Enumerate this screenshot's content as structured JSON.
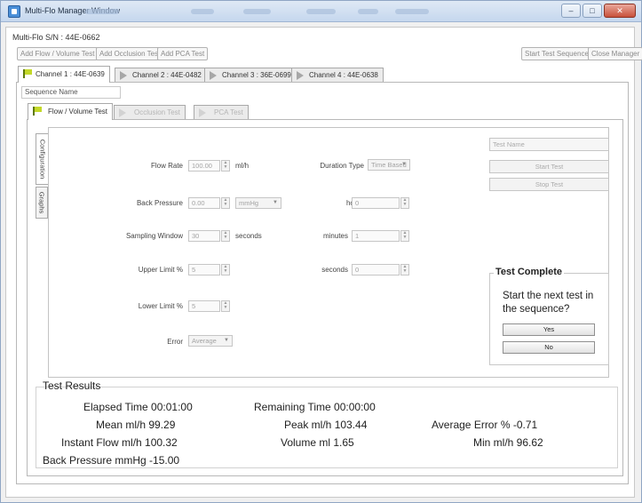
{
  "window": {
    "title": "Multi-Flo Manager Window",
    "controls": {
      "minimize": "–",
      "maximize": "□",
      "close": "✕"
    }
  },
  "serial_number": "Multi-Flo S/N : 44E-0662",
  "toolbar": {
    "add_flow": "Add Flow / Volume Test",
    "add_occlusion": "Add Occlusion Test",
    "add_pca": "Add PCA Test",
    "start_sequence": "Start Test Sequence",
    "close_manager": "Close Manager"
  },
  "channel_tabs": [
    {
      "label": "Channel 1 : 44E-0639"
    },
    {
      "label": "Channel 2 : 44E-0482"
    },
    {
      "label": "Channel 3 : 36E-0699"
    },
    {
      "label": "Channel 4 : 44E-0638"
    }
  ],
  "sequence_name_placeholder": "Sequence Name",
  "test_tabs": [
    {
      "label": "Flow / Volume Test"
    },
    {
      "label": "Occlusion Test"
    },
    {
      "label": "PCA Test"
    }
  ],
  "side_tabs": {
    "configuration": "Configuration",
    "graphs": "Graphs"
  },
  "config": {
    "flow_rate": {
      "label": "Flow Rate",
      "value": "100.00",
      "unit": "ml/h"
    },
    "back_pressure": {
      "label": "Back Pressure",
      "value": "0.00",
      "unit_option": "mmHg"
    },
    "sampling_window": {
      "label": "Sampling Window",
      "value": "30",
      "unit": "seconds"
    },
    "upper_limit": {
      "label": "Upper Limit %",
      "value": "5"
    },
    "lower_limit": {
      "label": "Lower Limit %",
      "value": "5"
    },
    "error": {
      "label": "Error",
      "value": "Average"
    },
    "duration_type": {
      "label": "Duration Type",
      "value": "Time Based"
    },
    "hours": {
      "label": "hours",
      "value": "0"
    },
    "minutes": {
      "label": "minutes",
      "value": "1"
    },
    "seconds": {
      "label": "seconds",
      "value": "0"
    }
  },
  "test_name_placeholder": "Test Name",
  "start_test": "Start Test",
  "stop_test": "Stop Test",
  "complete_dialog": {
    "title": "Test Complete",
    "question": "Start the next test in the sequence?",
    "yes": "Yes",
    "no": "No"
  },
  "results": {
    "title": "Test Results",
    "elapsed": "Elapsed Time 00:01:00",
    "remaining": "Remaining Time 00:00:00",
    "mean": "Mean ml/h 99.29",
    "peak": "Peak ml/h 103.44",
    "avg_error": "Average Error % -0.71",
    "instant_flow": "Instant Flow ml/h 100.32",
    "volume": "Volume ml 1.65",
    "min": "Min ml/h 96.62",
    "back_pressure": "Back Pressure mmHg -15.00"
  },
  "colors": {
    "flag": "#c3d829",
    "titlebar": "#c5d7ee",
    "close_button": "#c8503b"
  }
}
